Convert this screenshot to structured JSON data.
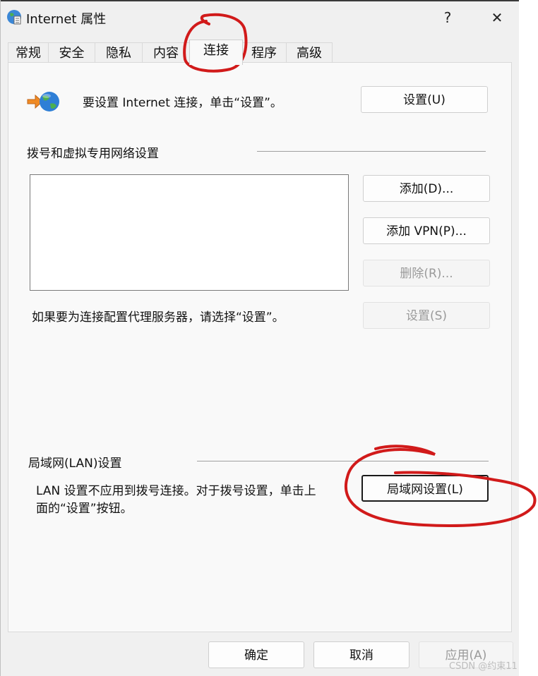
{
  "window": {
    "title": "Internet 属性",
    "help_label": "?",
    "close_label": "✕"
  },
  "tabs": [
    {
      "label": "常规"
    },
    {
      "label": "安全"
    },
    {
      "label": "隐私"
    },
    {
      "label": "内容"
    },
    {
      "label": "连接",
      "active": true
    },
    {
      "label": "程序"
    },
    {
      "label": "高级"
    }
  ],
  "setup": {
    "text": "要设置 Internet 连接，单击“设置”。",
    "button": "设置(U)"
  },
  "dialup": {
    "heading": "拨号和虚拟专用网络设置",
    "add_button": "添加(D)...",
    "add_vpn_button": "添加 VPN(P)...",
    "remove_button": "删除(R)...",
    "settings_button": "设置(S)",
    "proxy_text": "如果要为连接配置代理服务器，请选择“设置”。"
  },
  "lan": {
    "heading": "局域网(LAN)设置",
    "text_line1": "LAN 设置不应用到拨号连接。对于拨号设置，单击上",
    "text_line2": "面的“设置”按钮。",
    "button": "局域网设置(L)"
  },
  "footer": {
    "ok": "确定",
    "cancel": "取消",
    "apply": "应用(A)"
  },
  "watermark": "CSDN @约束11",
  "colors": {
    "annotation": "#d11a1a",
    "icon_arrow": "#f08a24",
    "globe": "#2f7fd6"
  }
}
